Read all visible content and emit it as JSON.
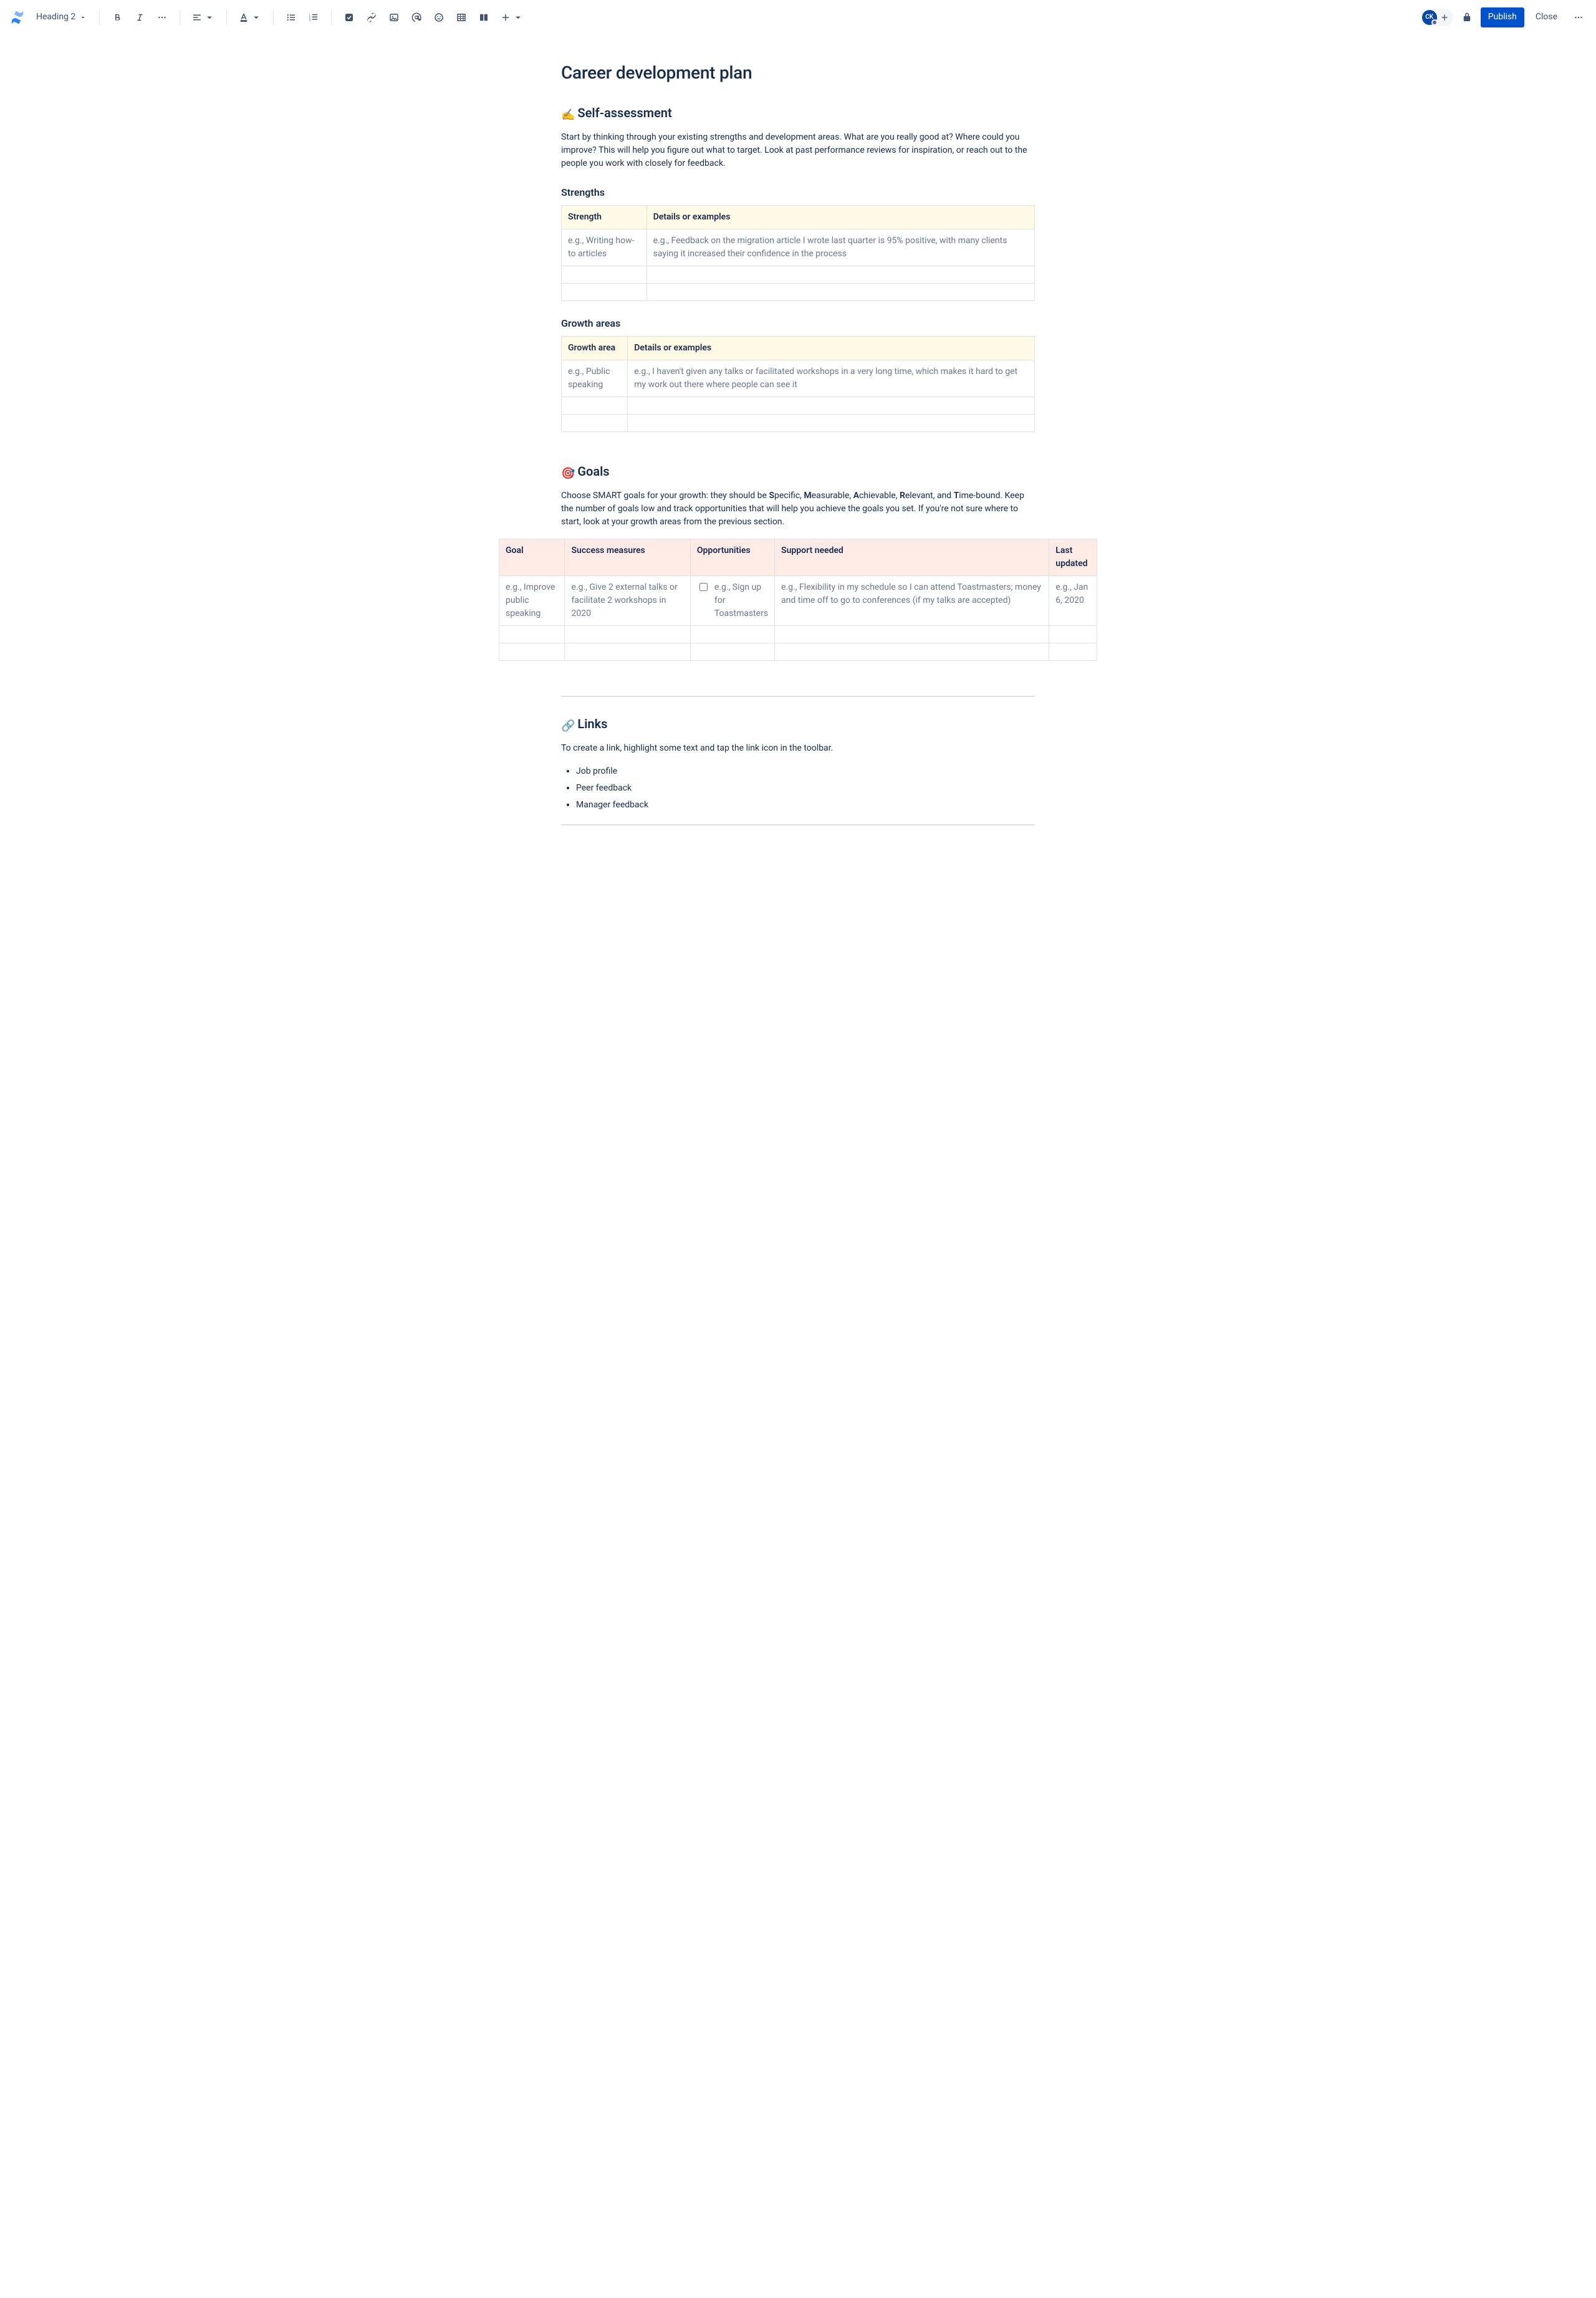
{
  "toolbar": {
    "heading_label": "Heading 2",
    "publish": "Publish",
    "close": "Close",
    "avatar_initials": "CK"
  },
  "page": {
    "title": "Career development plan"
  },
  "self_assessment": {
    "emoji": "✍️",
    "heading": "Self-assessment",
    "intro": "Start by thinking through your existing strengths and development areas. What are you really good at? Where could you improve? This will help you figure out what to target. Look at past performance reviews for inspiration, or reach out to the people you work with closely for feedback."
  },
  "strengths": {
    "heading": "Strengths",
    "cols": {
      "c1": "Strength",
      "c2": "Details or examples"
    },
    "row1": {
      "c1": "e.g., Writing how-to articles",
      "c2": "e.g., Feedback on the migration article I wrote last quarter is 95% positive, with many clients saying it increased their confidence in the process"
    }
  },
  "growth": {
    "heading": "Growth areas",
    "cols": {
      "c1": "Growth area",
      "c2": "Details or examples"
    },
    "row1": {
      "c1": "e.g., Public speaking",
      "c2": "e.g., I haven't given any talks or facilitated workshops in a very long time, which makes it hard to get my work out there where people can see it"
    }
  },
  "goals": {
    "emoji": "🎯",
    "heading": "Goals",
    "intro_pre": "Choose SMART goals for your growth: they should be ",
    "s": "S",
    "s_rest": "pecific, ",
    "m": "M",
    "m_rest": "easurable, ",
    "a": "A",
    "a_rest": "chievable, ",
    "r": "R",
    "r_rest": "elevant, and ",
    "t": "T",
    "t_rest": "ime-bound. Keep the number of goals low and track opportunities that will help you achieve the goals you set. If you're not sure where to start, look at your growth areas from the previous section.",
    "cols": {
      "goal": "Goal",
      "success": "Success measures",
      "opps": "Opportunities",
      "support": "Support needed",
      "updated": "Last updated"
    },
    "row1": {
      "goal": "e.g., Improve public speaking",
      "success": "e.g., Give 2 external talks or facilitate 2 workshops in 2020",
      "opps": "e.g., Sign up for Toastmasters",
      "support": "e.g., Flexibility in my schedule so I can attend Toastmasters; money and time off to go to conferences (if my talks are accepted)",
      "updated": "e.g., Jan 6, 2020"
    }
  },
  "links": {
    "emoji": "🔗",
    "heading": "Links",
    "intro": "To create a link, highlight some text and tap the link icon in the toolbar.",
    "items": [
      "Job profile",
      "Peer feedback",
      "Manager feedback"
    ]
  }
}
